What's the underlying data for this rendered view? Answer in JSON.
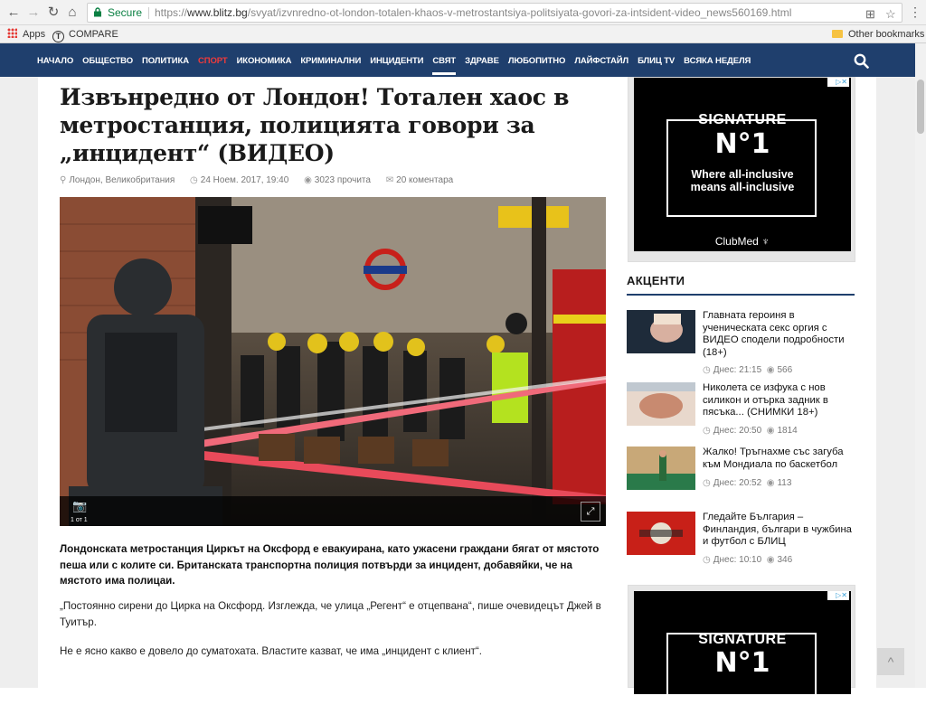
{
  "browser": {
    "secure_label": "Secure",
    "url_prefix": "https://",
    "url_domain": "www.blitz.bg",
    "url_path": "/svyat/izvnredno-ot-london-totalen-khaos-v-metrostantsiya-politsiyata-govori-za-intsident-video_news560169.html",
    "bookmarks": [
      {
        "label": "Apps",
        "icon": "apps-grid-icon"
      },
      {
        "label": "COMPARE",
        "icon": "t-logo-icon"
      }
    ],
    "other_bookmarks": "Other bookmarks"
  },
  "nav": {
    "items": [
      {
        "label": "НАЧАЛО"
      },
      {
        "label": "ОБЩЕСТВО"
      },
      {
        "label": "ПОЛИТИКА"
      },
      {
        "label": "СПОРТ",
        "color": "#f03a3a"
      },
      {
        "label": "ИКОНОМИКА"
      },
      {
        "label": "КРИМИНАЛНИ"
      },
      {
        "label": "ИНЦИДЕНТИ"
      },
      {
        "label": "СВЯТ",
        "active": true
      },
      {
        "label": "ЗДРАВЕ"
      },
      {
        "label": "ЛЮБОПИТНО"
      },
      {
        "label": "ЛАЙФСТАЙЛ"
      },
      {
        "label": "БЛИЦ TV"
      },
      {
        "label": "ВСЯКА НЕДЕЛЯ"
      }
    ],
    "bg_color": "#1f3f6d"
  },
  "article": {
    "title": "Извънредно от Лондон! Тотален хаос в метростанция, полицията говори за „инцидент“ (ВИДЕО)",
    "location": "Лондон, Великобритания",
    "date": "24 Ноем. 2017, 19:40",
    "views": "3023 прочита",
    "comments": "20 коментара",
    "photo_counter": "1 от 1",
    "lead": "Лондонската метростанция Циркът на Оксфорд е евакуирана, като ужасени граждани бягат от мястото пеша или с колите си. Британската транспортна полиция потвърди за инцидент, добавяйки, че на мястото има полицаи.",
    "paragraphs": [
      "„Постоянно сирени до Цирка на Оксфорд. Изглежда, че улица „Регент“ е отцепвана“, пише очевидецът Джей в Туитър.",
      "Не е ясно какво е довело до суматохата. Властите казват, че има „инцидент с клиент“."
    ]
  },
  "ads": [
    {
      "signature": "SIGNATURE",
      "number": "N°1",
      "line1": "Where all-inclusive",
      "line2": "means all-inclusive",
      "brand": "ClubMed ♆"
    },
    {
      "signature": "SIGNATURE",
      "number": "N°1"
    }
  ],
  "sidebar": {
    "section_title": "АКЦЕНТИ",
    "news": [
      {
        "title": "Главната героиня в ученическата секс оргия с ВИДЕО сподели подробности (18+)",
        "time": "Днес: 21:15",
        "views": "566"
      },
      {
        "title": "Николета се изфука с нов силикон и отърка задник в пясъка... (СНИМКИ 18+)",
        "time": "Днес: 20:50",
        "views": "1814"
      },
      {
        "title": "Жалко! Тръгнахме със загуба към Мондиала по баскетбол",
        "time": "Днес: 20:52",
        "views": "113"
      },
      {
        "title": "Гледайте България – Финландия, българи в чужбина и футбол с БЛИЦ",
        "time": "Днес: 10:10",
        "views": "346"
      }
    ]
  }
}
